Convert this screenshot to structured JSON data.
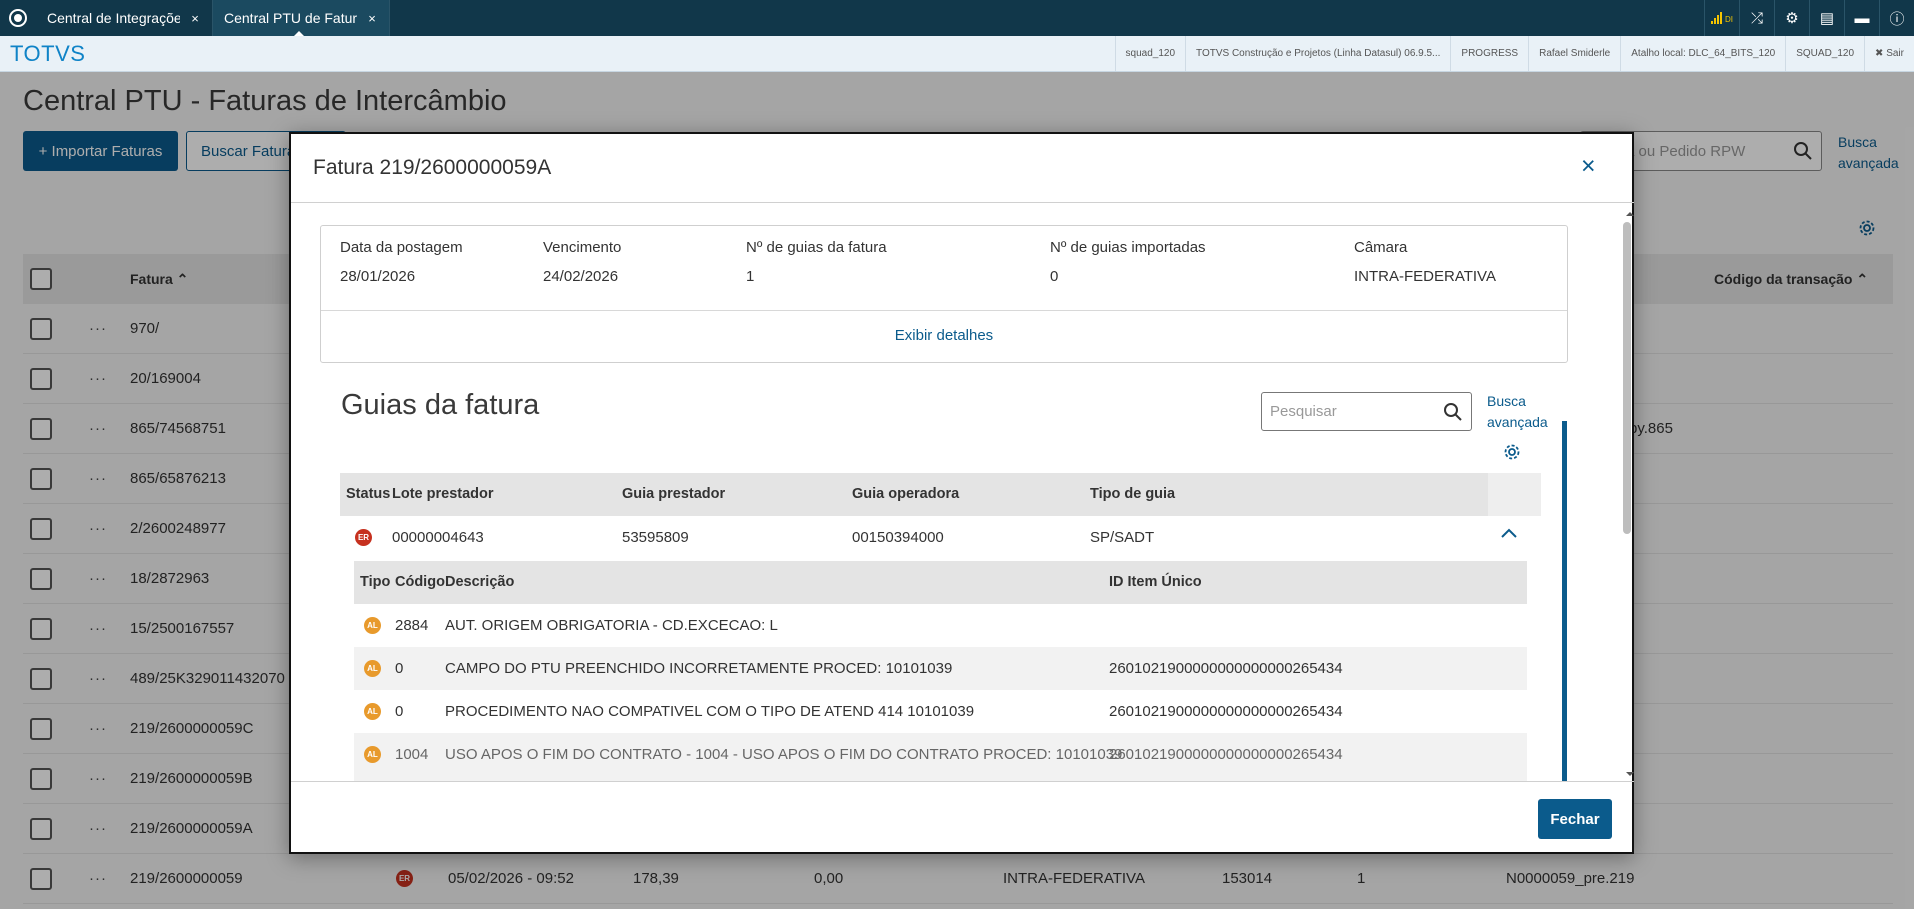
{
  "tabs": [
    {
      "label": "Central de Integrações",
      "close": "×"
    },
    {
      "label": "Central PTU de Fatura",
      "close": "×"
    }
  ],
  "tabbar_right": {
    "signal_label": "DI",
    "shuffle": "⤮",
    "gear": "⚙",
    "doc": "▤",
    "chat": "▬"
  },
  "appbar": {
    "brand": "TOTVS",
    "info": [
      "squad_120",
      "TOTVS Construção e Projetos (Linha Datasul) 06.9.5...",
      "PROGRESS",
      "Rafael Smiderle",
      "Atalho local: DLC_64_BITS_120",
      "SQUAD_120",
      "✖ Sair"
    ]
  },
  "page": {
    "title": "Central PTU - Faturas de Intercâmbio",
    "import_button": "+ Importar Faturas",
    "search_button": "Buscar Faturas",
    "search_placeholder": "Fatura ou Pedido RPW",
    "advanced_line1": "Busca",
    "advanced_line2": "avançada",
    "columns": {
      "fatura": "Fatura ⌃",
      "codigo": "Código da transação ⌃"
    },
    "rows": [
      {
        "fatura": "970/",
        "extra": ""
      },
      {
        "fatura": "20/169004",
        "extra": ""
      },
      {
        "fatura": "865/74568751",
        "extra": "py.865"
      },
      {
        "fatura": "865/65876213",
        "extra": ""
      },
      {
        "fatura": "2/2600248977",
        "extra": ""
      },
      {
        "fatura": "18/2872963",
        "extra": ""
      },
      {
        "fatura": "15/2500167557",
        "extra": ""
      },
      {
        "fatura": "489/25K329011432070",
        "extra": ""
      },
      {
        "fatura": "219/2600000059C",
        "extra": ""
      },
      {
        "fatura": "219/2600000059B",
        "extra": ""
      },
      {
        "fatura": "219/2600000059A",
        "extra": ""
      }
    ],
    "last_row": {
      "fatura": "219/2600000059",
      "status": "ER",
      "date": "05/02/2026 - 09:52",
      "v1": "178,39",
      "v2": "0,00",
      "camara": "INTRA-FEDERATIVA",
      "n1": "153014",
      "n2": "1",
      "codigo": "N0000059_pre.219"
    }
  },
  "modal": {
    "title": "Fatura 219/2600000059A",
    "close": "×",
    "summary": {
      "data_postagem_label": "Data da postagem",
      "data_postagem": "28/01/2026",
      "vencimento_label": "Vencimento",
      "vencimento": "24/02/2026",
      "guias_label": "Nº de guias da fatura",
      "guias": "1",
      "importadas_label": "Nº de guias importadas",
      "importadas": "0",
      "camara_label": "Câmara",
      "camara": "INTRA-FEDERATIVA",
      "details_link": "Exibir detalhes"
    },
    "guias": {
      "title": "Guias da fatura",
      "search_placeholder": "Pesquisar",
      "advanced_line1": "Busca",
      "advanced_line2": "avançada",
      "columns": {
        "status": "Status",
        "lote": "Lote prestador",
        "guia_prestador": "Guia prestador",
        "guia_operadora": "Guia operadora",
        "tipo": "Tipo de guia"
      },
      "row": {
        "status": "ER",
        "lote": "00000004643",
        "guia_prestador": "53595809",
        "guia_operadora": "00150394000",
        "tipo": "SP/SADT"
      },
      "sub_columns": {
        "tipo": "Tipo",
        "codigo": "Código",
        "descricao": "Descrição",
        "id": "ID Item Único"
      },
      "sub_rows": [
        {
          "tipo": "AL",
          "codigo": "2884",
          "descricao": "AUT. ORIGEM OBRIGATORIA - CD.EXCECAO: L",
          "id": ""
        },
        {
          "tipo": "AL",
          "codigo": "0",
          "descricao": "CAMPO DO PTU PREENCHIDO INCORRETAMENTE PROCED: 10101039",
          "id": "2601021900000000000000265434"
        },
        {
          "tipo": "AL",
          "codigo": "0",
          "descricao": "PROCEDIMENTO NAO COMPATIVEL COM O TIPO DE ATEND 414 10101039",
          "id": "2601021900000000000000265434"
        },
        {
          "tipo": "AL",
          "codigo": "1004",
          "descricao": "USO APOS O FIM DO CONTRATO - 1004 - USO APOS O FIM DO CONTRATO PROCED: 10101039",
          "id": "2601021900000000000000265434"
        }
      ]
    },
    "close_button": "Fechar"
  }
}
